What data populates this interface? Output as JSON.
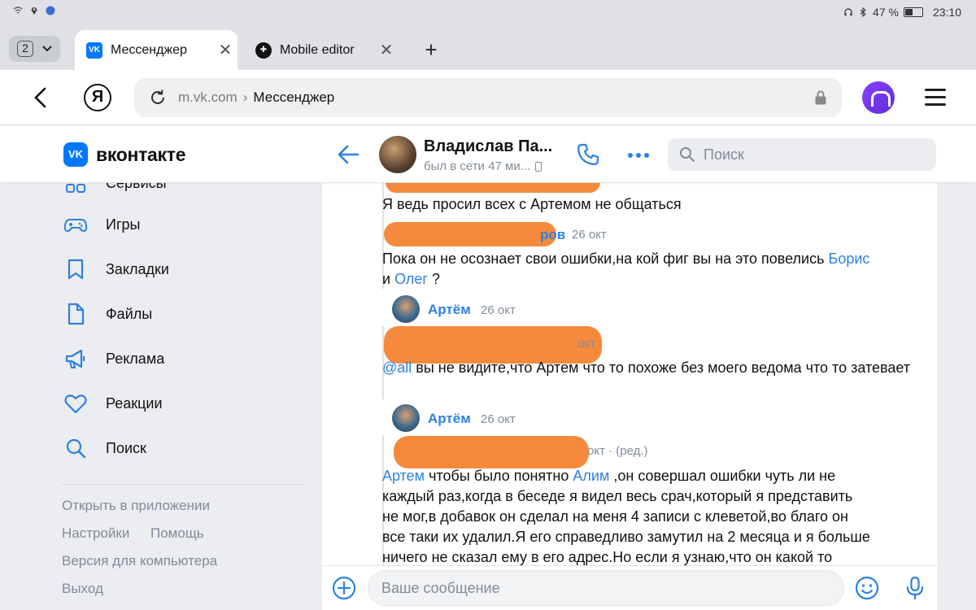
{
  "status_bar": {
    "battery": "47 %",
    "time": "23:10"
  },
  "browser": {
    "tab_count": "2",
    "tabs": [
      {
        "title": "Мессенджер",
        "active": true
      },
      {
        "title": "Mobile editor",
        "active": false
      }
    ],
    "url_domain": "m.vk.com",
    "url_separator": "›",
    "url_page": "Мессенджер",
    "yandex_letter": "Я"
  },
  "vk": {
    "logo_mark": "VK",
    "logo_text": "вконтакте",
    "chat_title": "Владислав Па...",
    "chat_status": "был в сети 47 ми...",
    "search_placeholder": "Поиск",
    "accent_color": "#2d81e0"
  },
  "sidebar": {
    "partial_item": "Сервисы",
    "items": [
      {
        "label": "Игры",
        "icon": "gamepad-icon"
      },
      {
        "label": "Закладки",
        "icon": "bookmark-icon"
      },
      {
        "label": "Файлы",
        "icon": "file-icon"
      },
      {
        "label": "Реклама",
        "icon": "megaphone-icon"
      },
      {
        "label": "Реакции",
        "icon": "heart-icon"
      },
      {
        "label": "Поиск",
        "icon": "search-icon"
      }
    ],
    "footer": {
      "open_app": "Открыть в приложении",
      "settings": "Настройки",
      "help": "Помощь",
      "desktop": "Версия для компьютера",
      "logout": "Выход"
    }
  },
  "messages": {
    "m1_text": "Я ведь просил всех с Артемом не общаться",
    "m2_sender_tail": "ров",
    "m2_time": "26 окт",
    "m2_text_a": "Пока он не осознает свои ошибки,на кой фиг вы на это повелись",
    "m2_link1": "Борис",
    "m2_text_b": "и",
    "m2_link2": "Олег",
    "m2_text_c": "?",
    "m3_sender": "Артём",
    "m3_time": "26 окт",
    "m4_time_tail": "окт",
    "m4_mention": "@all",
    "m4_text": "вы не видите,что Артем что то похоже без моего ведома что то затевает",
    "m5_sender": "Артём",
    "m5_time": "26 окт",
    "m6_time_tail": "окт · (ред.)",
    "m6_link1": "Артем",
    "m6_text_a": "чтобы было понятно",
    "m6_link2": "Алим",
    "m6_text_b": ",он совершал ошибки чуть ли не",
    "m6_line2": "каждый раз,когда в беседе я видел весь срач,который я представить",
    "m6_line3": "не мог,в добавок он сделал на меня 4 записи с клеветой,во благо он",
    "m6_line4": "все таки их удалил.Я его справедливо замутил на 2 месяца и я больше",
    "m6_line5": "ничего не сказал ему в его адрес.Но если я узнаю,что он какой то"
  },
  "composer": {
    "placeholder": "Ваше сообщение"
  }
}
